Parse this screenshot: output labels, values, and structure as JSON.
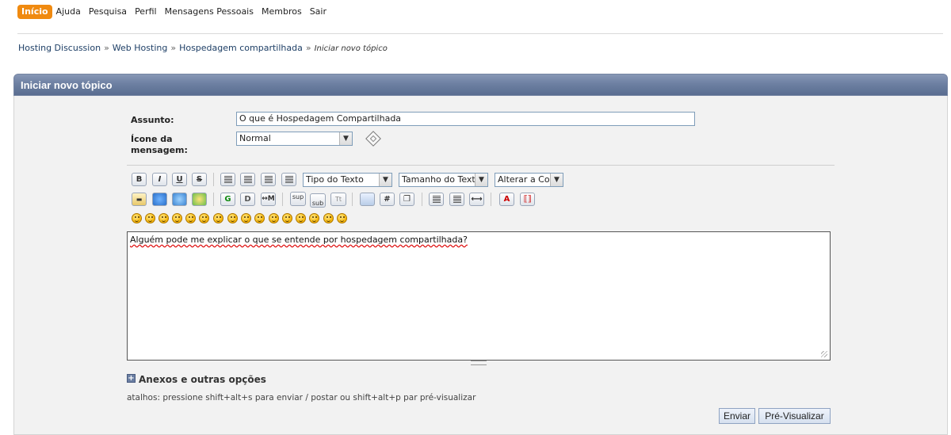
{
  "nav": {
    "items": [
      "Início",
      "Ajuda",
      "Pesquisa",
      "Perfil",
      "Mensagens Pessoais",
      "Membros",
      "Sair"
    ]
  },
  "breadcrumb": {
    "items": [
      "Hosting Discussion",
      "Web Hosting",
      "Hospedagem compartilhada"
    ],
    "separator": "»",
    "current": "Iniciar novo tópico"
  },
  "panel": {
    "title": "Iniciar novo tópico"
  },
  "form": {
    "subject_label": "Assunto:",
    "subject_value": "O que é Hospedagem Compartilhada",
    "icon_label": "Ícone da mensagem:",
    "icon_value": "Normal"
  },
  "toolbar": {
    "bold": "B",
    "italic": "I",
    "underline": "U",
    "strike": "S",
    "font_face": "Tipo do Texto",
    "font_size": "Tamanho do Texto",
    "font_color": "Alterar a Cor",
    "glow": "G",
    "shadow": "D",
    "marquee": "↔M",
    "sup": "sup",
    "sub": "sub",
    "teletype": "Tt",
    "hash": "#"
  },
  "editor": {
    "message": "Alguém pode me explicar o que se entende por hospedagem compartilhada?"
  },
  "attachments": {
    "title": "Anexos e outras opções",
    "toggle": "+"
  },
  "hint": "atalhos: pressione shift+alt+s para enviar / postar ou shift+alt+p par pré-visualizar",
  "buttons": {
    "send": "Enviar",
    "preview": "Pré-Visualizar"
  },
  "colors": {
    "nav_active": "#f08a10",
    "header": "#6d80a2",
    "link": "#1e3f66"
  }
}
